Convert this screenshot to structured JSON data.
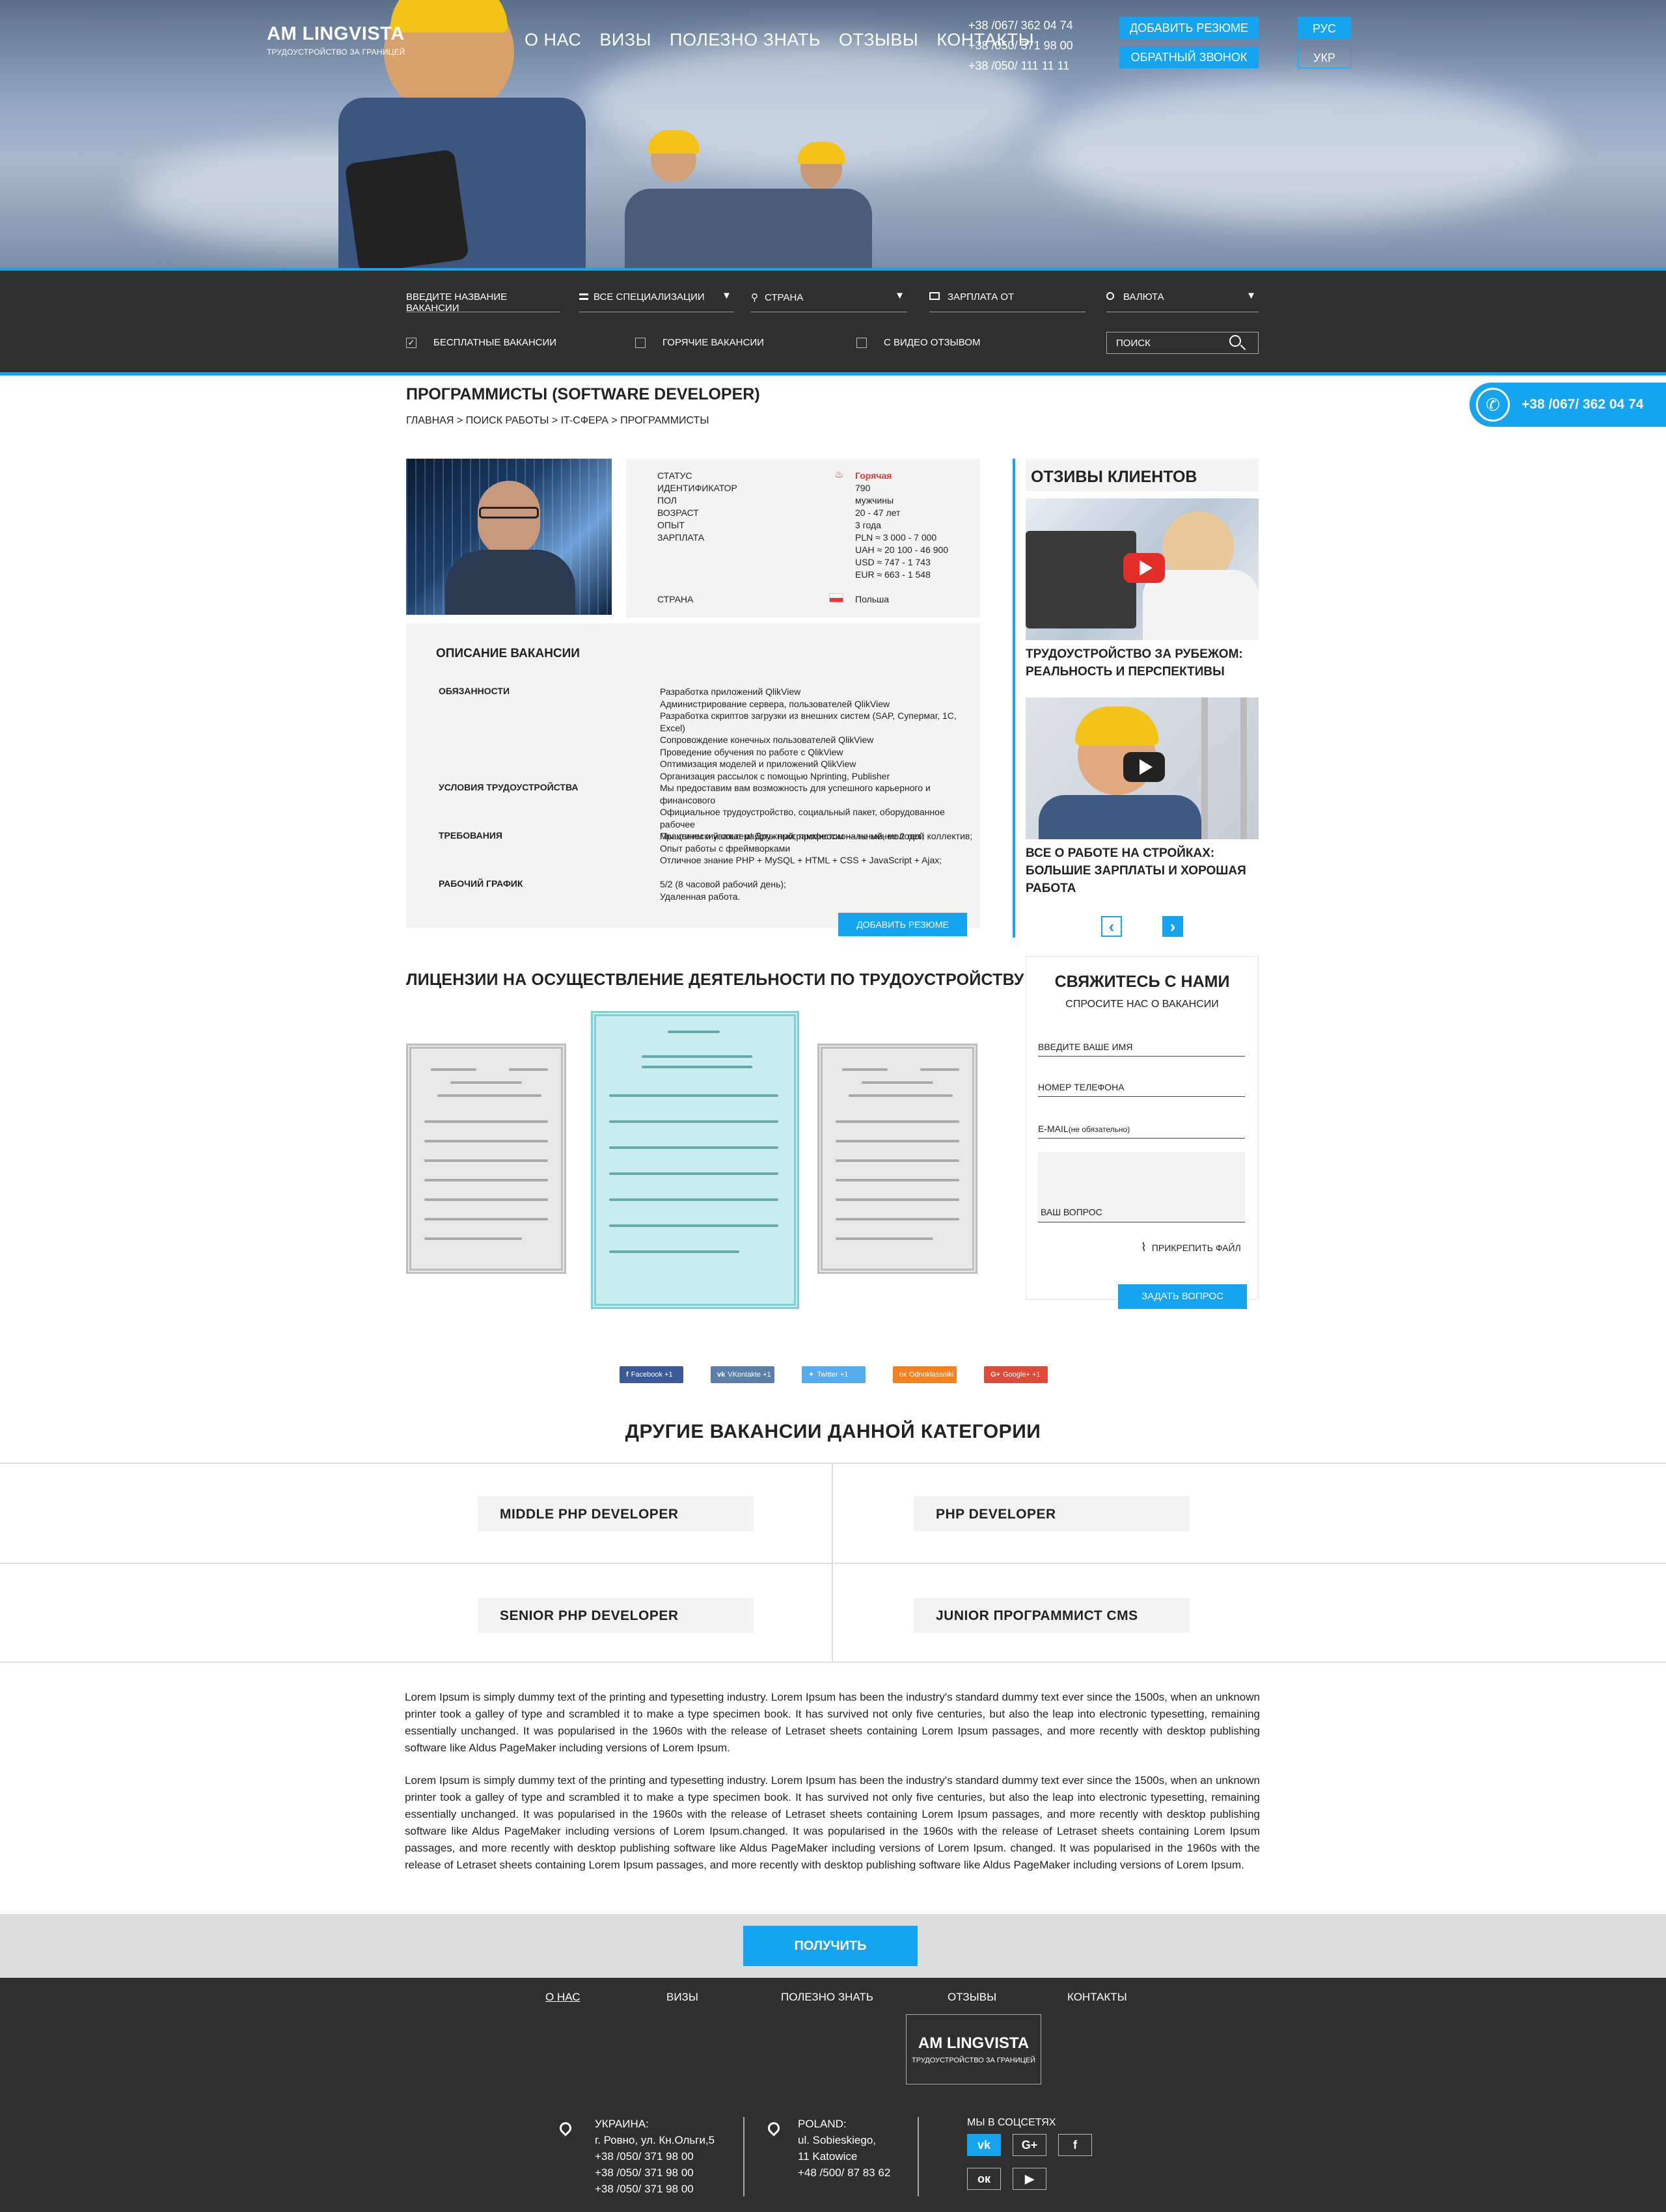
{
  "brand": {
    "name": "AM LINGVISTA",
    "tagline": "ТРУДОУСТРОЙСТВО ЗА ГРАНИЦЕЙ"
  },
  "nav": [
    "О НАС",
    "ВИЗЫ",
    "ПОЛЕЗНО ЗНАТЬ",
    "ОТЗЫВЫ",
    "КОНТАКТЫ"
  ],
  "phones": [
    "+38 /067/ 362 04 74",
    "+38 /050/ 371 98 00",
    "+38 /050/ 111 11 11"
  ],
  "header_buttons": {
    "add_resume": "ДОБАВИТЬ РЕЗЮМЕ",
    "callback": "ОБРАТНЫЙ ЗВОНОК"
  },
  "languages": [
    "РУС",
    "УКР"
  ],
  "filter": {
    "vacancy_placeholder": "ВВЕДИТЕ НАЗВАНИЕ ВАКАНСИИ",
    "specialization": "ВСЕ СПЕЦИАЛИЗАЦИИ",
    "country": "СТРАНА",
    "salary": "ЗАРПЛАТА ОТ",
    "currency": "ВАЛЮТА",
    "free": "БЕСПЛАТНЫЕ ВАКАНСИИ",
    "hot": "ГОРЯЧИЕ ВАКАНСИИ",
    "video": "С ВИДЕО ОТЗЫВОМ",
    "search_placeholder": "ПОИСК",
    "free_checked": "✓"
  },
  "callback_phone": "+38 /067/ 362 04 74",
  "page": {
    "title": "ПРОГРАММИСТЫ (SOFTWARE DEVELOPER)",
    "breadcrumb": "ГЛАВНАЯ > ПОИСК РАБОТЫ > IT-СФЕРА > ПРОГРАММИСТЫ"
  },
  "info": {
    "labels": [
      "СТАТУС",
      "ИДЕНТИФИКАТОР",
      "ПОЛ",
      "ВОЗРАСТ",
      "ОПЫТ",
      "ЗАРПЛАТА"
    ],
    "status": "Горячая",
    "id": "790",
    "gender": "мужчины",
    "age": "20 - 47 лет",
    "experience": "3 года",
    "salary": [
      "PLN ≈ 3 000 - 7 000",
      "UAH ≈ 20 100 - 46 900",
      "USD ≈ 747 - 1 743",
      "EUR ≈ 663 - 1 548"
    ],
    "country_label": "СТРАНА",
    "country": "Польша"
  },
  "description": {
    "title": "ОПИСАНИЕ ВАКАНСИИ",
    "sections": [
      {
        "label": "ОБЯЗАННОСТИ",
        "lines": [
          "Разработка приложений QlikView",
          "Администрирование сервера, пользователей QlikView",
          "Разработка скриптов загрузки из внешних систем (SAP, Супермаг, 1С, Excel)",
          "Сопровождение конечных пользователей QlikView",
          "Проведение обучения по работе с QlikView",
          "Оптимизация моделей и приложений QlikView",
          "Организация рассылок с помощью Nprinting, Publisher"
        ]
      },
      {
        "label": "УСЛОВИЯ ТРУДОУСТРОЙСТВА",
        "lines": [
          "Мы предоставим вам возможность для успешного карьерного и финансового",
          "Официальное трудоустройство, социальный пакет, оборудованное рабочее",
          "Мы ценим и уважаем! Дружный, профессиональный, молодой коллектив;"
        ]
      },
      {
        "label": "ТРЕБОВАНИЯ",
        "lines": [
          "Практический опыт работы программистом — не менее 2 лет;",
          "Опыт работы с фреймворками",
          "Отличное знание PHP + MySQL + HTML + CSS + JavaScript + Ajax;"
        ]
      },
      {
        "label": "РАБОЧИЙ ГРАФИК",
        "lines": [
          "5/2 (8 часовой рабочий день);",
          "Удаленная работа."
        ]
      }
    ],
    "add_resume": "ДОБАВИТЬ РЕЗЮМЕ"
  },
  "reviews": {
    "title": "ОТЗИВЫ КЛИЕНТОВ",
    "items": [
      "ТРУДОУСТРОЙСТВО ЗА РУБЕЖОМ: РЕАЛЬНОСТЬ И ПЕРСПЕКТИВЫ",
      "ВСЕ О РАБОТЕ НА СТРОЙКАХ: БОЛЬШИЕ ЗАРПЛАТЫ И ХОРОШАЯ РАБОТА"
    ]
  },
  "licenses_title": "ЛИЦЕНЗИИ НА ОСУЩЕСТВЛЕНИЕ ДЕЯТЕЛЬНОСТИ ПО ТРУДОУСТРОЙСТВУ",
  "contact": {
    "title": "СВЯЖИТЕСЬ С НАМИ",
    "subtitle": "СПРОСИТЕ НАС О ВАКАНСИИ",
    "name": "ВВЕДИТЕ ВАШЕ ИМЯ",
    "phone": "НОМЕР ТЕЛЕФОНА",
    "email": "E-MAIL",
    "email_note": "(не обязательно)",
    "question": "ВАШ ВОПРОС",
    "attach": "ПРИКРЕПИТЬ ФАЙЛ",
    "submit": "ЗАДАТЬ ВОПРОС"
  },
  "social_share": [
    {
      "label": "Facebook",
      "count": "+1",
      "color": "#3b5998"
    },
    {
      "label": "VKontakte",
      "count": "+1",
      "color": "#5b7fa6"
    },
    {
      "label": "Twitter",
      "count": "+1",
      "color": "#55acee"
    },
    {
      "label": "Odnoklassniki",
      "count": "+1",
      "color": "#f58220"
    },
    {
      "label": "Google+",
      "count": "+1",
      "color": "#dd4b39"
    }
  ],
  "other_vacancies": {
    "title": "ДРУГИЕ ВАКАНСИИ ДАННОЙ КАТЕГОРИИ",
    "items": [
      "MIDDLE PHP DEVELOPER",
      "PHP DEVELOPER",
      "SENIOR PHP DEVELOPER",
      "JUNIOR ПРОГРАММИСТ CMS"
    ]
  },
  "seo_text": [
    "Lorem Ipsum is simply dummy text of the printing and typesetting industry. Lorem Ipsum has been the industry's standard dummy text ever since the 1500s, when an unknown printer took a galley of type and scrambled it to make a type specimen book. It has survived not only five centuries, but also the leap into electronic typesetting, remaining essentially unchanged. It was popularised in the 1960s with the release of Letraset sheets containing Lorem Ipsum passages, and more recently with desktop publishing software like Aldus PageMaker including versions of Lorem Ipsum.",
    "Lorem Ipsum is simply dummy text of the printing and typesetting industry. Lorem Ipsum has been the industry's standard dummy text ever since the 1500s, when an unknown printer took a galley of type and scrambled it to make a type specimen book. It has survived not only five centuries, but also the leap into electronic typesetting, remaining essentially unchanged. It was popularised in the 1960s with the release of Letraset sheets containing Lorem Ipsum passages, and more recently with desktop publishing software like Aldus PageMaker including versions of Lorem Ipsum.changed. It was popularised in the 1960s with the release of Letraset sheets containing Lorem Ipsum passages, and more recently with desktop publishing software like Aldus PageMaker including versions of Lorem Ipsum. changed. It was popularised in the 1960s with the release of Letraset sheets containing Lorem Ipsum passages, and more recently with desktop publishing software like Aldus PageMaker including versions of Lorem Ipsum."
  ],
  "consult_button": "ПОЛУЧИТЬ КОНСУЛЬТАЦИЮ",
  "footer": {
    "nav": [
      "О НАС",
      "ВИЗЫ",
      "ПОЛЕЗНО ЗНАТЬ",
      "ОТЗЫВЫ",
      "КОНТАКТЫ"
    ],
    "ukraine": [
      "УКРАИНА:",
      "г. Ровно, ул. Кн.Ольги,5",
      "+38 /050/ 371 98 00",
      "+38 /050/ 371 98 00",
      "+38 /050/ 371 98 00"
    ],
    "poland": [
      "POLAND:",
      "ul. Sobieskiego,",
      "11 Katowice",
      "+48 /500/ 87 83 62"
    ],
    "social_title": "МЫ В СОЦСЕТЯХ",
    "social_icons": [
      "vk-icon",
      "google-plus-icon",
      "facebook-icon",
      "odnoklassniki-icon",
      "youtube-icon"
    ],
    "social_glyphs": [
      "vk",
      "G+",
      "f",
      "ок",
      "▶"
    ]
  },
  "colors": {
    "accent": "#15a4ef",
    "dark": "#2f2f2f",
    "panel": "#f3f3f3",
    "hot": "#e53935"
  }
}
